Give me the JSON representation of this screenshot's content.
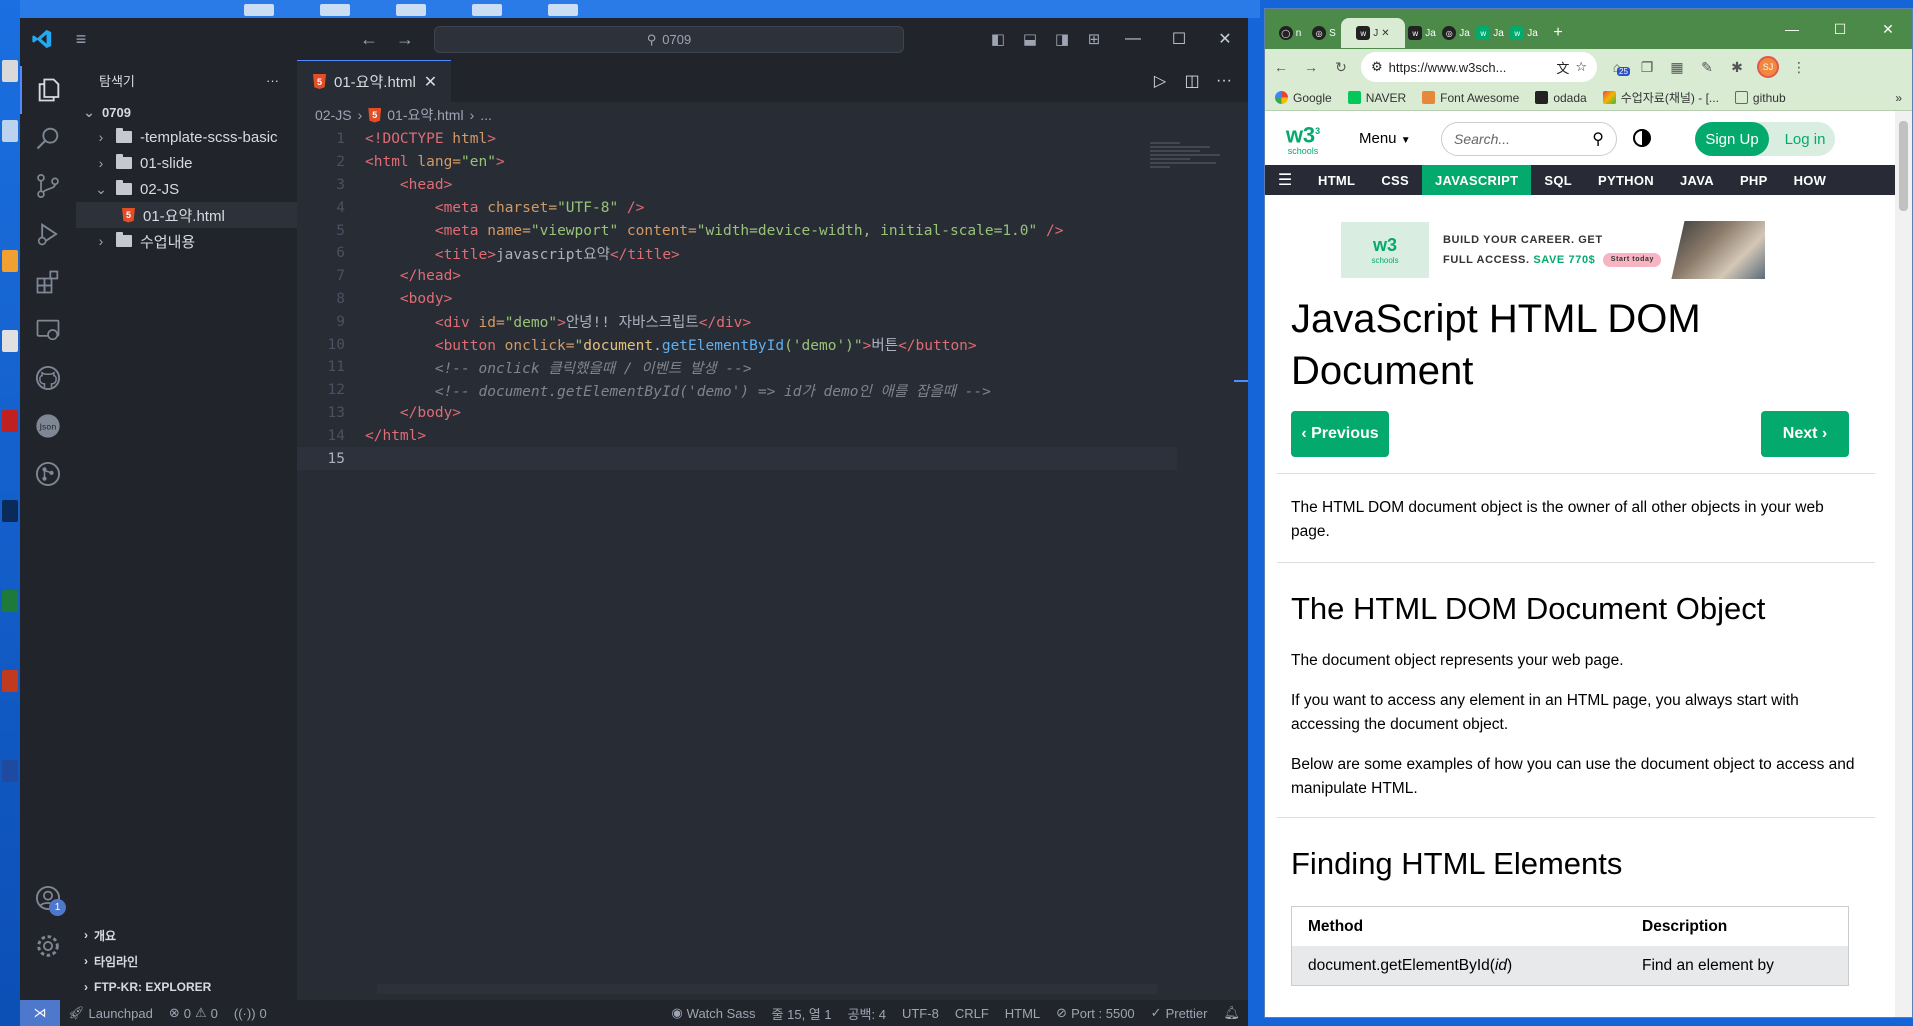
{
  "vscode": {
    "command_center": "0709",
    "sidebar": {
      "title": "탐색기",
      "more": "···",
      "root": "0709",
      "items": [
        {
          "label": "-template-scss-basic"
        },
        {
          "label": "01-slide"
        },
        {
          "label": "02-JS"
        },
        {
          "label": "01-요약.html"
        },
        {
          "label": "수업내용"
        }
      ],
      "sections": [
        "개요",
        "타임라인",
        "FTP-KR: EXPLORER"
      ]
    },
    "tab": {
      "label": "01-요약.html",
      "close": "✕"
    },
    "breadcrumb": {
      "folder": "02-JS",
      "file": "01-요약.html",
      "more": "..."
    },
    "line_numbers": [
      "1",
      "2",
      "3",
      "4",
      "5",
      "6",
      "7",
      "8",
      "9",
      "10",
      "11",
      "12",
      "13",
      "14",
      "15"
    ],
    "code": {
      "l1_doctype": "<!DOCTYPE",
      "l1_html": " html",
      "l1_end": ">",
      "l2_open": "<html",
      "l2_attr": " lang=",
      "l2_val": "\"en\"",
      "l2_end": ">",
      "l3": "<head>",
      "l4_tag": "<meta",
      "l4_attr": " charset=",
      "l4_val": "\"UTF-8\"",
      "l4_end": " />",
      "l5_tag": "<meta",
      "l5_attr1": " name=",
      "l5_val1": "\"viewport\"",
      "l5_attr2": " content=",
      "l5_val2": "\"width=device-width, initial-scale=1.0\"",
      "l5_end": " />",
      "l6_open": "<title>",
      "l6_text": "javascript요약",
      "l6_close": "</title>",
      "l7": "</head>",
      "l8": "<body>",
      "l9_open": "<div",
      "l9_attr": " id=",
      "l9_val": "\"demo\"",
      "l9_gt": ">",
      "l9_text": "안녕!! 자바스크립트",
      "l9_close": "</div>",
      "l10_open": "<button",
      "l10_attr": " onclick=",
      "l10_q1": "\"",
      "l10_obj": "document",
      "l10_dot": ".",
      "l10_fn": "getElementById",
      "l10_arg": "('demo')",
      "l10_q2": "\"",
      "l10_gt": ">",
      "l10_text": "버튼",
      "l10_close": "</button>",
      "l11": "<!-- onclick 클릭했을때 / 이벤트 발생 -->",
      "l12": "<!-- document.getElementById('demo') => id가 demo인 애를 잡을때 -->",
      "l13": "</body>",
      "l14": "</html>"
    },
    "status": {
      "launchpad": "Launchpad",
      "errors": "0",
      "warnings": "0",
      "ports": "0",
      "watch_sass": "Watch Sass",
      "cursor": "줄 15, 열 1",
      "spaces": "공백: 4",
      "encoding": "UTF-8",
      "eol": "CRLF",
      "language": "HTML",
      "port": "Port : 5500",
      "prettier": "Prettier"
    },
    "accent": "#528bff"
  },
  "browser": {
    "tabs": [
      {
        "label": "n",
        "icon": "github-icon"
      },
      {
        "label": "S",
        "icon": "globe-icon"
      },
      {
        "label": "J",
        "icon": "w3schools-icon",
        "active": true
      },
      {
        "label": "Ja",
        "icon": "w3schools-icon"
      },
      {
        "label": "Ja",
        "icon": "globe-icon"
      },
      {
        "label": "Ja",
        "icon": "w3schools-icon"
      },
      {
        "label": "Ja",
        "icon": "w3schools-icon"
      }
    ],
    "url": "https://www.w3sch...",
    "extension_badge": "25",
    "profile": "SJ",
    "bookmarks": [
      "Google",
      "NAVER",
      "Font Awesome",
      "odada",
      "수업자료(채널) - [...",
      "github"
    ],
    "w3": {
      "logo": "w3",
      "logo_sup": "3",
      "logo_sub": "schools",
      "menu": "Menu",
      "search_placeholder": "Search...",
      "signup": "Sign Up",
      "login": "Log in",
      "nav": [
        "HTML",
        "CSS",
        "JAVASCRIPT",
        "SQL",
        "PYTHON",
        "JAVA",
        "PHP",
        "HOW"
      ],
      "ad_line1": "BUILD YOUR CAREER. GET",
      "ad_line2": "FULL ACCESS.",
      "ad_save": "SAVE 770$",
      "ad_button": "Start today",
      "title": "JavaScript HTML DOM Document",
      "prev": "Previous",
      "next": "Next",
      "intro": "The HTML DOM document object is the owner of all other objects in your web page.",
      "h2_1": "The HTML DOM Document Object",
      "p1": "The document object represents your web page.",
      "p2": "If you want to access any element in an HTML page, you always start with accessing the document object.",
      "p3": "Below are some examples of how you can use the document object to access and manipulate HTML.",
      "h2_2": "Finding HTML Elements",
      "table": {
        "headers": [
          "Method",
          "Description"
        ],
        "row1_method": "document.getElementById(",
        "row1_arg": "id",
        "row1_end": ")",
        "row1_desc": "Find an element by"
      },
      "brand_color": "#04aa6d"
    }
  }
}
